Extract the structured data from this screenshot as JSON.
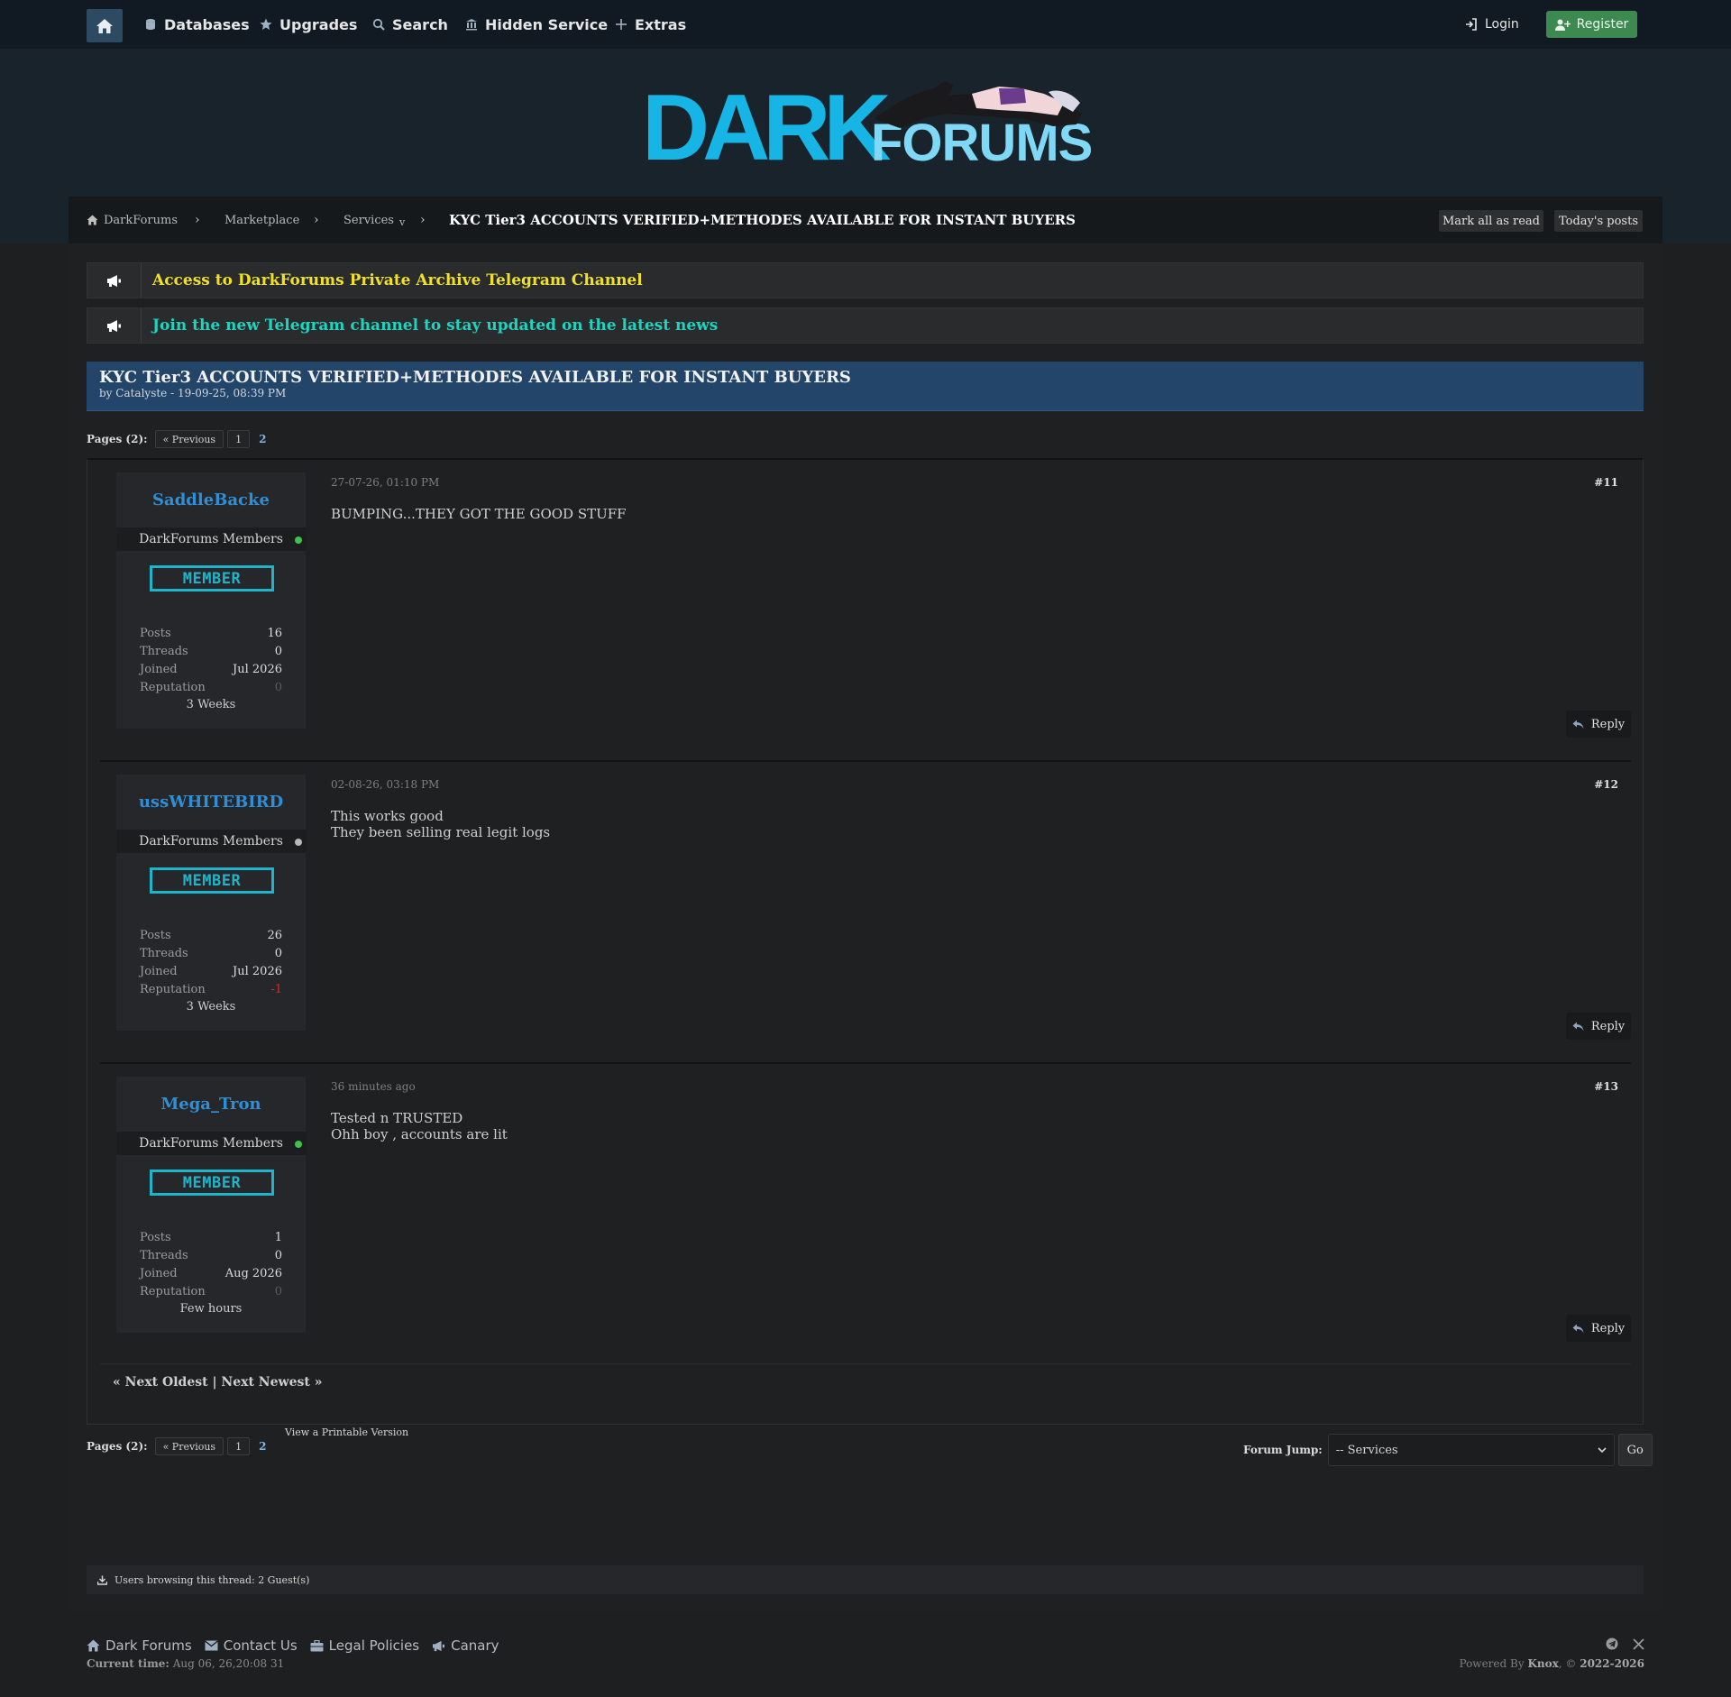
{
  "nav": {
    "items": [
      {
        "label": "Databases",
        "icon": "database-icon"
      },
      {
        "label": "Upgrades",
        "icon": "star-icon"
      },
      {
        "label": "Search",
        "icon": "search-icon"
      },
      {
        "label": "Hidden Service",
        "icon": "hidden-service-icon"
      },
      {
        "label": "Extras",
        "icon": "plus-icon"
      }
    ],
    "login_label": "Login",
    "register_label": "Register"
  },
  "logo": {
    "dark": "DARK",
    "forums": "FORUMS"
  },
  "breadcrumb": {
    "items": [
      "DarkForums",
      "Marketplace",
      "Services",
      "KYC Tier3 ACCOUNTS VERIFIED+METHODES AVAILABLE FOR INSTANT BUYERS"
    ],
    "dropdown_marker": "v",
    "mark_read_label": "Mark all as read",
    "todays_posts_label": "Today's posts"
  },
  "announcements": [
    {
      "text": "Access to DarkForums Private Archive Telegram Channel",
      "color": "#f0e02a"
    },
    {
      "text": "Join the new Telegram channel to stay updated on the latest news",
      "color": "#1fd3c0"
    }
  ],
  "thread": {
    "title": "KYC Tier3 ACCOUNTS VERIFIED+METHODES AVAILABLE FOR INSTANT BUYERS",
    "byline": "by Catalyste - 19-09-25, 08:39 PM"
  },
  "pagination": {
    "label": "Pages (2):",
    "prev": "« Previous",
    "page1": "1",
    "page2": "2"
  },
  "stat_labels": {
    "posts": "Posts",
    "threads": "Threads",
    "joined": "Joined",
    "reputation": "Reputation"
  },
  "posts": [
    {
      "author": "SaddleBacke",
      "group": "DarkForums Members",
      "online": true,
      "badge": "MEMBER",
      "posts": "16",
      "threads": "0",
      "joined": "Jul 2026",
      "reputation": "0",
      "time_online": "3 Weeks",
      "date": "27-07-26, 01:10 PM",
      "number": "#11",
      "body": [
        "BUMPING...THEY GOT THE GOOD STUFF"
      ],
      "reply_label": "Reply"
    },
    {
      "author": "ussWHITEBIRD",
      "group": "DarkForums Members",
      "online": false,
      "badge": "MEMBER",
      "posts": "26",
      "threads": "0",
      "joined": "Jul 2026",
      "reputation": "-1",
      "time_online": "3 Weeks",
      "date": "02-08-26, 03:18 PM",
      "number": "#12",
      "body": [
        "This works good",
        "They been selling real legit logs"
      ],
      "reply_label": "Reply"
    },
    {
      "author": "Mega_Tron",
      "group": "DarkForums Members",
      "online": true,
      "badge": "MEMBER",
      "posts": "1",
      "threads": "0",
      "joined": "Aug 2026",
      "reputation": "0",
      "time_online": "Few hours",
      "date": "36 minutes ago",
      "number": "#13",
      "body": [
        "Tested n TRUSTED",
        "Ohh boy , accounts are lit"
      ],
      "reply_label": "Reply"
    }
  ],
  "next_links": "« Next Oldest | Next Newest »",
  "printable_label": "View a Printable Version",
  "forum_jump": {
    "label": "Forum Jump:",
    "selected": "-- Services",
    "go_label": "Go"
  },
  "browsing": "Users browsing this thread: 2 Guest(s)",
  "footer": {
    "links": [
      {
        "label": "Dark Forums",
        "icon": "home-icon"
      },
      {
        "label": "Contact Us",
        "icon": "envelope-icon"
      },
      {
        "label": "Legal Policies",
        "icon": "briefcase-icon"
      },
      {
        "label": "Canary",
        "icon": "megaphone-icon"
      }
    ],
    "current_time_label": "Current time:",
    "current_time_value": "Aug 06, 26,20:08 31",
    "powered_prefix": "Powered By",
    "powered_by": "Knox",
    "powered_suffix": ", ©",
    "copyright": "2022-2026"
  },
  "colors": {
    "accent": "#2d4a63",
    "register": "#3c8a4f",
    "username": "#2f8fd6",
    "badge": "#1fb4c9",
    "online": "#3ec24a",
    "offline": "#b8b8b8",
    "negative": "#d22d2d"
  }
}
